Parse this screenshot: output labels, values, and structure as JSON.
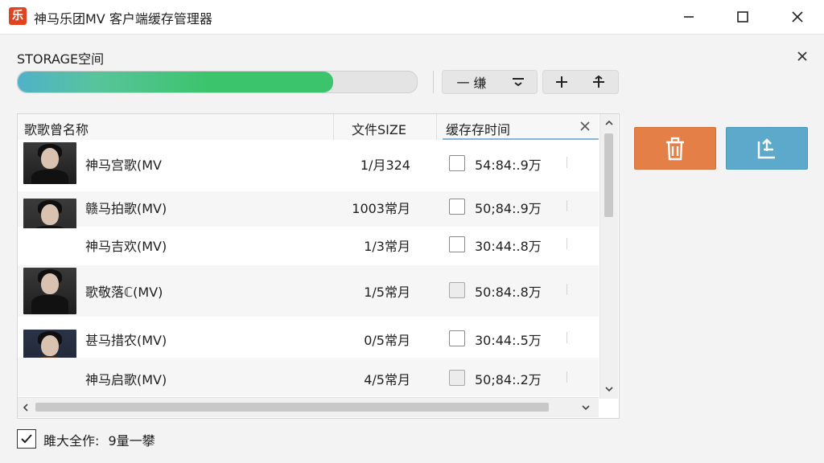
{
  "window": {
    "title": "神马乐团MV 客户端缓存管理器",
    "app_icon_glyph": "乐"
  },
  "storage": {
    "label": "STORAGE空间",
    "used_fraction": 0.79
  },
  "toolbar": {
    "collapse_label": "一 缣",
    "filter_icon": "filter-icon",
    "add_icon": "plus-icon",
    "pin_icon": "pin-icon"
  },
  "table": {
    "columns": [
      "歌歌曾名称",
      "文件SIZE",
      "缓存存时间"
    ],
    "rows": [
      {
        "name": "神马宫歌(MV",
        "size": "1/月324",
        "time": "54:84:.9万"
      },
      {
        "name": "赣马拍歌(MV)",
        "size": "1003常月",
        "time": "50;84:.9万"
      },
      {
        "name": "神马吉欢(MV)",
        "size": "1/3常月",
        "time": "30:44:.8万"
      },
      {
        "name": "歌敬落ℂ(MV)",
        "size": "1/5常月",
        "time": "50:84:.8万"
      },
      {
        "name": "甚马措农(MV)",
        "size": "0/5常月",
        "time": "30:44:.5万"
      },
      {
        "name": "神马启歌(MV)",
        "size": "4/5常月",
        "time": "50;84:.2万"
      }
    ]
  },
  "actions": {
    "delete_color": "#e37f47",
    "export_color": "#5da9cc"
  },
  "footer": {
    "select_all_label": "雎大全作:",
    "select_all_count": "9量一攀",
    "checked": true
  }
}
